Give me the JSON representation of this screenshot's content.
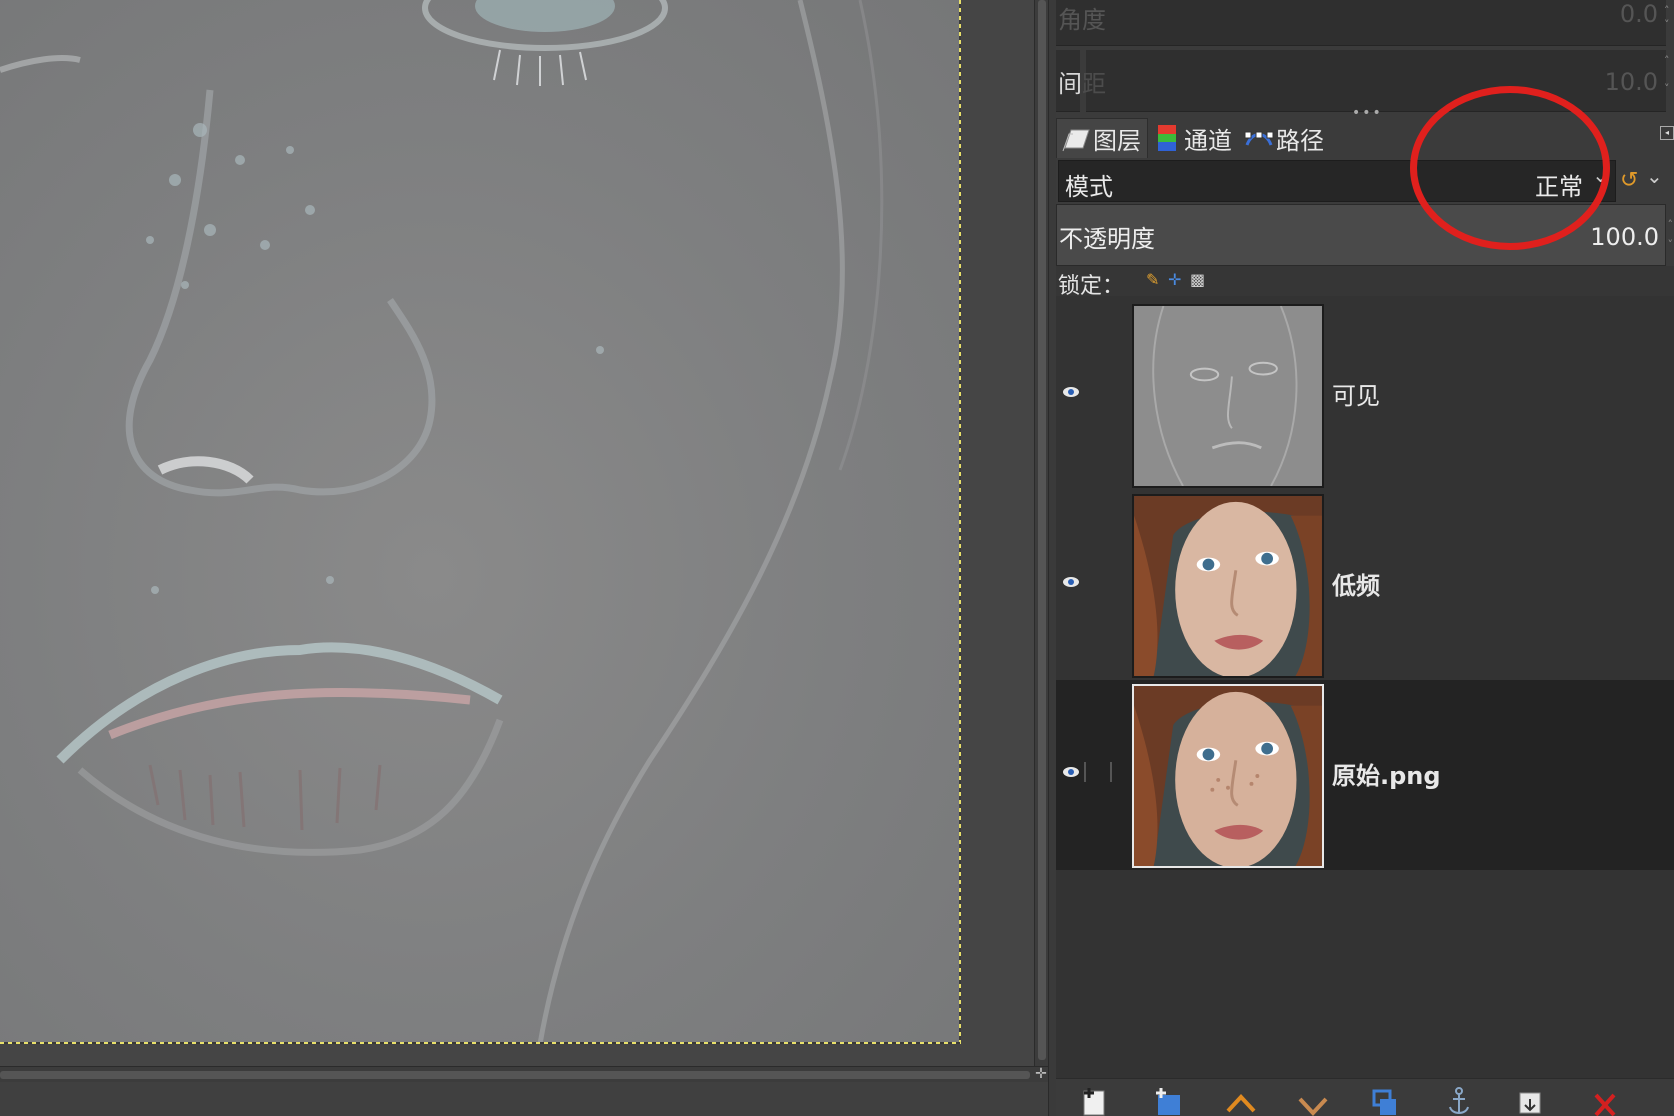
{
  "tool_options": {
    "angle_label": "角度",
    "angle_value": "0.0",
    "spacing_label_visible": "间",
    "spacing_label_faded": "距",
    "spacing_value": "10.0"
  },
  "tabs": [
    {
      "label": "图层",
      "icon": "layers-icon"
    },
    {
      "label": "通道",
      "icon": "channels-icon"
    },
    {
      "label": "路径",
      "icon": "paths-icon"
    }
  ],
  "mode": {
    "label": "模式",
    "value": "正常"
  },
  "opacity": {
    "label": "不透明度",
    "value": "100.0"
  },
  "lock": {
    "label": "锁定："
  },
  "layers": [
    {
      "name": "可见",
      "bold": false,
      "visible": true,
      "selected": false,
      "thumbnail": "emboss"
    },
    {
      "name": "低频",
      "bold": true,
      "visible": true,
      "selected": false,
      "thumbnail": "portrait"
    },
    {
      "name": "原始.png",
      "bold": true,
      "visible": true,
      "selected": true,
      "thumbnail": "portrait"
    }
  ],
  "colors": {
    "annotation": "#e0201d",
    "selection_border": "#e8e06a",
    "mode_switch_icon": "#e09a2a",
    "delete_icon": "#d42020"
  },
  "bottom_buttons": [
    "new-layer-icon",
    "new-layer-group-icon",
    "raise-layer-icon",
    "lower-layer-icon",
    "duplicate-layer-icon",
    "anchor-layer-icon",
    "merge-down-icon",
    "delete-layer-icon"
  ]
}
